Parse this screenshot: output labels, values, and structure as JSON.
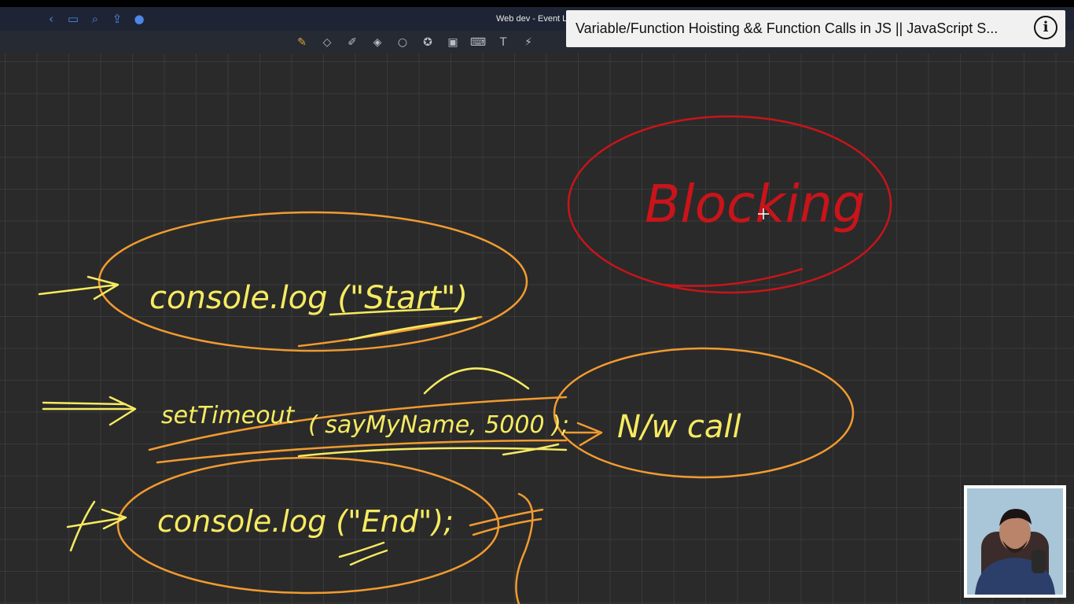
{
  "titlebar": {
    "doc_title": "Web dev - Event L",
    "nav_icons": [
      "back-icon",
      "sidebar-icon",
      "search-icon",
      "share-icon",
      "microphone-icon"
    ]
  },
  "toolbar": {
    "tools": [
      "pen-icon",
      "eraser-icon",
      "highlighter-icon",
      "shapes-icon",
      "lasso-icon",
      "sticker-icon",
      "image-icon",
      "keyboard-icon",
      "text-icon",
      "laser-pointer-icon"
    ]
  },
  "video": {
    "title": "Variable/Function Hoisting && Function Calls in JS || JavaScript S...",
    "info_symbol": "i"
  },
  "whiteboard": {
    "notes": {
      "blocking": "Blocking",
      "line1": "console.log (\"Start\")",
      "line2_fn": "setTimeout",
      "line2_args": "( sayMyName, 5000 );",
      "network_call": "N/w call",
      "line3": "console.log (\"End\");"
    },
    "ink_colors": {
      "yellow": "#f6eb61",
      "orange": "#f29b30",
      "red": "#c8141a"
    }
  }
}
